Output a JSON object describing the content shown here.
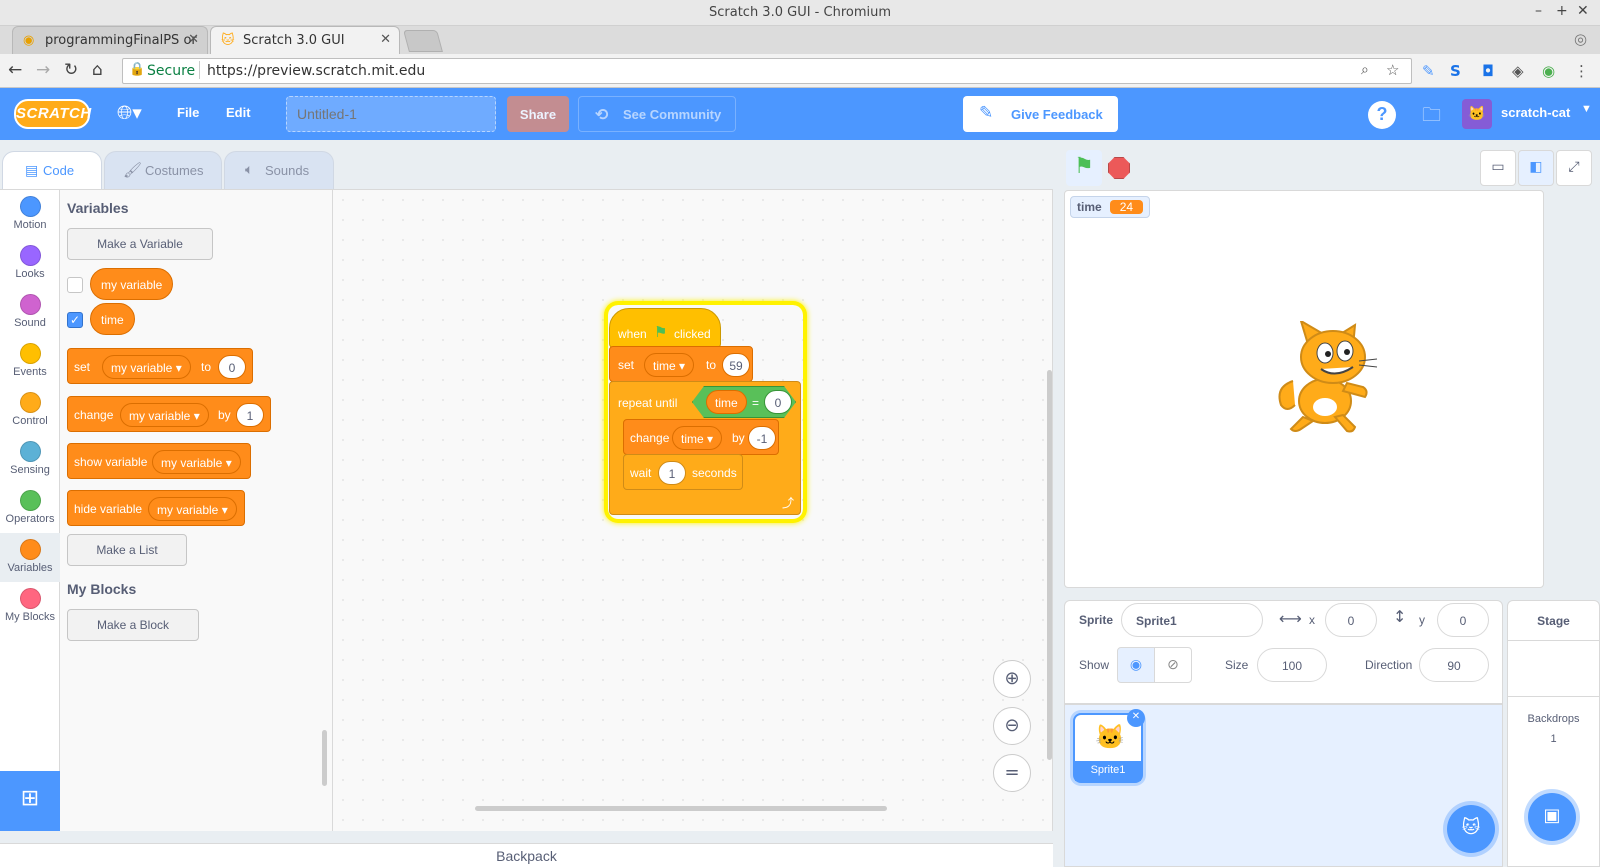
{
  "window": {
    "title": "Scratch 3.0 GUI - Chromium"
  },
  "browser": {
    "tabs": [
      {
        "label": "programmingFinalPS or"
      },
      {
        "label": "Scratch 3.0 GUI"
      }
    ],
    "secure_label": "Secure",
    "url": "https://preview.scratch.mit.edu"
  },
  "menubar": {
    "logo": "SCRATCH",
    "file": "File",
    "edit": "Edit",
    "project_title_placeholder": "Untitled-1",
    "share": "Share",
    "see_community": "See Community",
    "give_feedback": "Give Feedback",
    "username": "scratch-cat"
  },
  "editor_tabs": {
    "code": "Code",
    "costumes": "Costumes",
    "sounds": "Sounds"
  },
  "categories": [
    {
      "label": "Motion",
      "color": "#4c97ff"
    },
    {
      "label": "Looks",
      "color": "#9966ff"
    },
    {
      "label": "Sound",
      "color": "#cf63cf"
    },
    {
      "label": "Events",
      "color": "#ffbf00"
    },
    {
      "label": "Control",
      "color": "#ffab19"
    },
    {
      "label": "Sensing",
      "color": "#5cb1d6"
    },
    {
      "label": "Operators",
      "color": "#59c059"
    },
    {
      "label": "Variables",
      "color": "#ff8c1a"
    },
    {
      "label": "My Blocks",
      "color": "#ff6680"
    }
  ],
  "flyout": {
    "variables_heading": "Variables",
    "make_variable": "Make a Variable",
    "var1": "my variable",
    "var2": "time",
    "set_block": {
      "label": "set",
      "var": "my variable",
      "to": "to",
      "value": "0"
    },
    "change_block": {
      "label": "change",
      "var": "my variable",
      "by": "by",
      "value": "1"
    },
    "show_block": {
      "label": "show variable",
      "var": "my variable"
    },
    "hide_block": {
      "label": "hide variable",
      "var": "my variable"
    },
    "make_list": "Make a List",
    "myblocks_heading": "My Blocks",
    "make_block": "Make a Block"
  },
  "script": {
    "hat_when": "when",
    "hat_clicked": "clicked",
    "set_label": "set",
    "set_var": "time",
    "set_to": "to",
    "set_value": "59",
    "repeat_label": "repeat until",
    "cond_var": "time",
    "cond_op": "=",
    "cond_value": "0",
    "change_label": "change",
    "change_var": "time",
    "change_by": "by",
    "change_value": "-1",
    "wait_label": "wait",
    "wait_value": "1",
    "wait_unit": "seconds"
  },
  "backpack": "Backpack",
  "stage": {
    "monitor_label": "time",
    "monitor_value": "24"
  },
  "sprite_info": {
    "sprite_label": "Sprite",
    "sprite_name": "Sprite1",
    "x_label": "x",
    "x_value": "0",
    "y_label": "y",
    "y_value": "0",
    "show_label": "Show",
    "size_label": "Size",
    "size_value": "100",
    "direction_label": "Direction",
    "direction_value": "90"
  },
  "sprites": [
    {
      "name": "Sprite1"
    }
  ],
  "stage_panel": {
    "title": "Stage",
    "backdrops_label": "Backdrops",
    "backdrops_count": "1"
  }
}
